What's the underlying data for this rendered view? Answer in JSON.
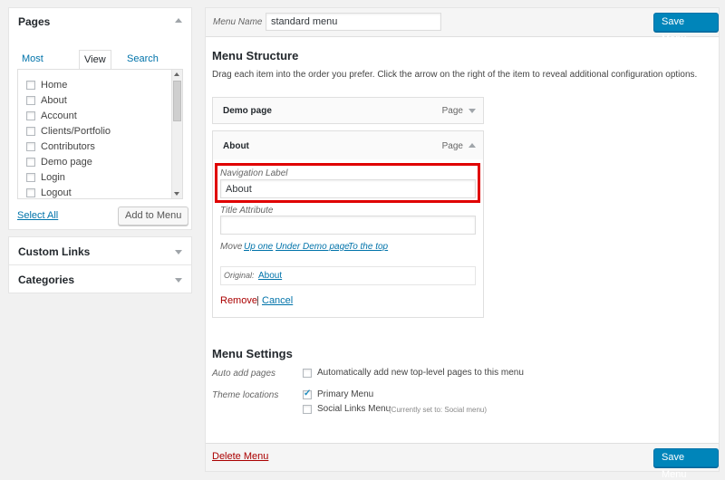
{
  "sidebar": {
    "pages_box": {
      "title": "Pages",
      "tabs": [
        "Most Recent",
        "View All",
        "Search"
      ],
      "items": [
        {
          "label": "Home",
          "checked": false
        },
        {
          "label": "About",
          "checked": false
        },
        {
          "label": "Account",
          "checked": false
        },
        {
          "label": "Clients/Portfolio",
          "checked": false
        },
        {
          "label": "Contributors",
          "checked": false
        },
        {
          "label": "Demo page",
          "checked": false
        },
        {
          "label": "Login",
          "checked": false
        },
        {
          "label": "Logout",
          "checked": false
        }
      ],
      "select_all": "Select All",
      "add_button": "Add to Menu"
    },
    "custom_links_title": "Custom Links",
    "categories_title": "Categories"
  },
  "header": {
    "menu_name_label": "Menu Name",
    "menu_name_value": "standard menu",
    "save_button": "Save Menu"
  },
  "structure": {
    "title": "Menu Structure",
    "description": "Drag each item into the order you prefer. Click the arrow on the right of the item to reveal additional configuration options.",
    "items": [
      {
        "title": "Demo page",
        "type": "Page"
      },
      {
        "title": "About",
        "type": "Page"
      }
    ],
    "expanded": {
      "navigation_label": "Navigation Label",
      "navigation_value": "About",
      "title_attribute_label": "Title Attribute",
      "title_attribute_value": "",
      "move_label": "Move",
      "move_links": [
        "Up one",
        "Under Demo page",
        "To the top"
      ],
      "original_label": "Original:",
      "original_link": "About",
      "remove": "Remove",
      "separator": "|",
      "cancel": "Cancel"
    }
  },
  "settings": {
    "title": "Menu Settings",
    "auto_add_label": "Auto add pages",
    "auto_add_option": "Automatically add new top-level pages to this menu",
    "auto_add_checked": false,
    "theme_locations_label": "Theme locations",
    "locations": [
      {
        "label": "Primary Menu",
        "note": "",
        "checked": true
      },
      {
        "label": "Social Links Menu",
        "note": "(Currently set to: Social menu)",
        "checked": false
      }
    ]
  },
  "footer": {
    "delete_menu": "Delete Menu",
    "save_button": "Save Menu"
  },
  "colors": {
    "accent": "#0085ba",
    "link": "#0073aa",
    "delete": "#a00",
    "highlight": "#e00000"
  }
}
